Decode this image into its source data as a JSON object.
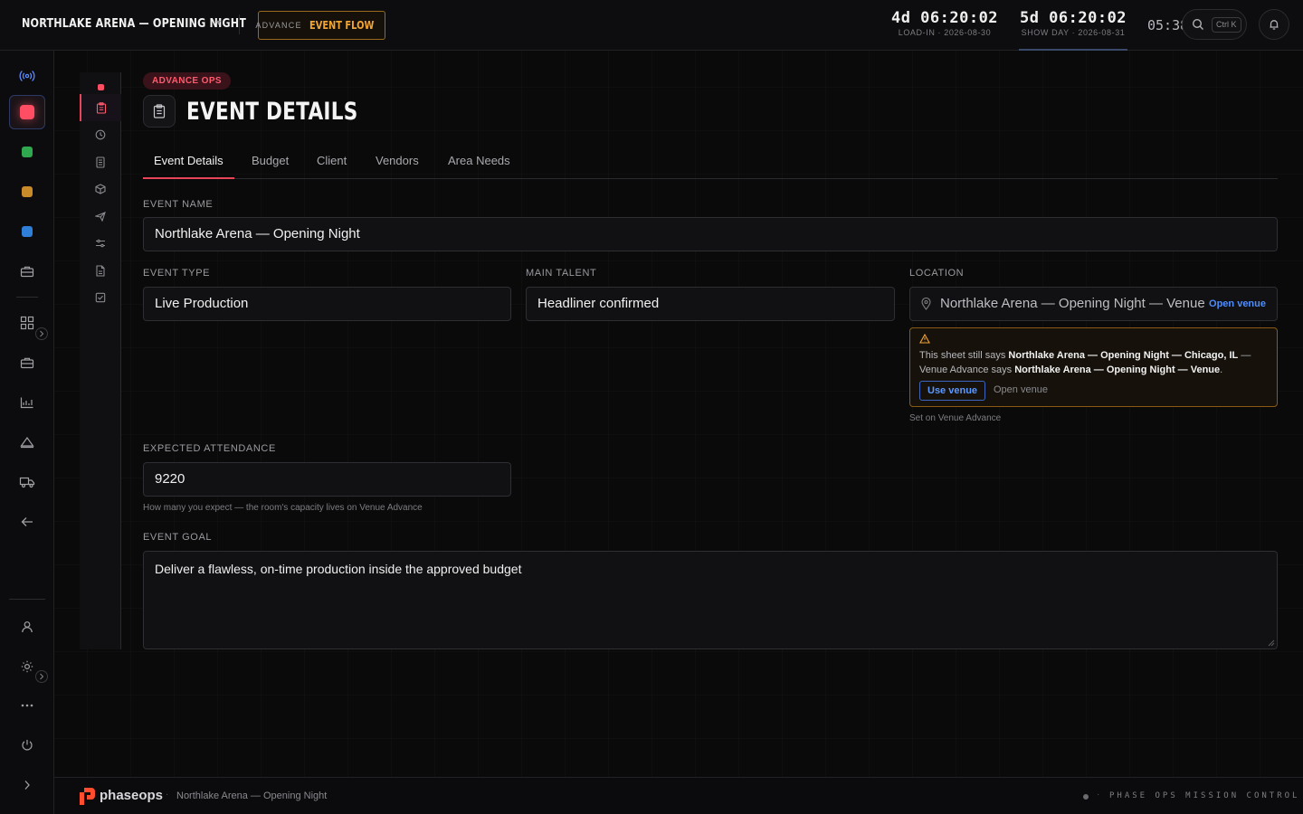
{
  "topbar": {
    "project_title": "NORTHLAKE ARENA — OPENING NIGHT",
    "project_caret": "▾",
    "mode": {
      "sub": "ADVANCE",
      "main": "EVENT FLOW"
    },
    "countdowns": [
      {
        "value": "4d 06:20:02",
        "label": "LOAD-IN · 2026-08-30"
      },
      {
        "value": "5d 06:20:02",
        "label": "SHOW DAY · 2026-08-31"
      }
    ],
    "clock": "05:38",
    "search_shortcut": "Ctrl K"
  },
  "rail": {
    "icons": [
      "broadcast-icon",
      "red-status",
      "green-status",
      "amber-status",
      "blue-status",
      "briefcase-icon",
      "grid-icon",
      "briefcase-icon",
      "chart-icon",
      "tent-icon",
      "truck-icon",
      "arrow-left-icon",
      "user-icon",
      "sun-icon",
      "more-icon",
      "power-icon",
      "chevron-right-icon"
    ],
    "status_colors": {
      "red": "#ff4d63",
      "green": "#2fa84f",
      "amber": "#c98a2a",
      "blue": "#2f7fd8"
    }
  },
  "subrail": {
    "icons": [
      "red-dot",
      "clipboard-icon",
      "clock-icon",
      "document-icon",
      "box-icon",
      "plane-icon",
      "sliders-icon",
      "file-icon",
      "checkbox-icon"
    ]
  },
  "page": {
    "badge": "ADVANCE OPS",
    "title": "EVENT DETAILS",
    "tabs": [
      "Event Details",
      "Budget",
      "Client",
      "Vendors",
      "Area Needs"
    ],
    "active_tab": "Event Details"
  },
  "form": {
    "event_name": {
      "label": "EVENT NAME",
      "value": "Northlake Arena — Opening Night"
    },
    "event_type": {
      "label": "EVENT TYPE",
      "value": "Live Production"
    },
    "main_talent": {
      "label": "MAIN TALENT",
      "value": "Headliner confirmed"
    },
    "location": {
      "label": "LOCATION",
      "value": "Northlake Arena — Opening Night — Venue",
      "link": "Open venue",
      "hint": "Set on Venue Advance"
    },
    "warning": {
      "t1": "This sheet still says ",
      "b1": "Northlake Arena — Opening Night — Chicago, IL",
      "t2": " — Venue Advance says ",
      "b2": "Northlake Arena — Opening Night — Venue",
      "t3": ".",
      "primary_button": "Use venue",
      "secondary_link": "Open venue"
    },
    "attendance": {
      "label": "EXPECTED ATTENDANCE",
      "value": "9220",
      "hint": "How many you expect — the room's capacity lives on Venue Advance"
    },
    "goal": {
      "label": "EVENT GOAL",
      "value": "Deliver a flawless, on-time production inside the approved budget"
    }
  },
  "footer": {
    "brand": "phaseops",
    "project": "Northlake Arena — Opening Night",
    "mission": "PHASE OPS MISSION CONTROL"
  },
  "colors": {
    "accent_red": "#e8445a",
    "accent_amber": "#f2a531",
    "link_blue": "#4d8dff"
  }
}
